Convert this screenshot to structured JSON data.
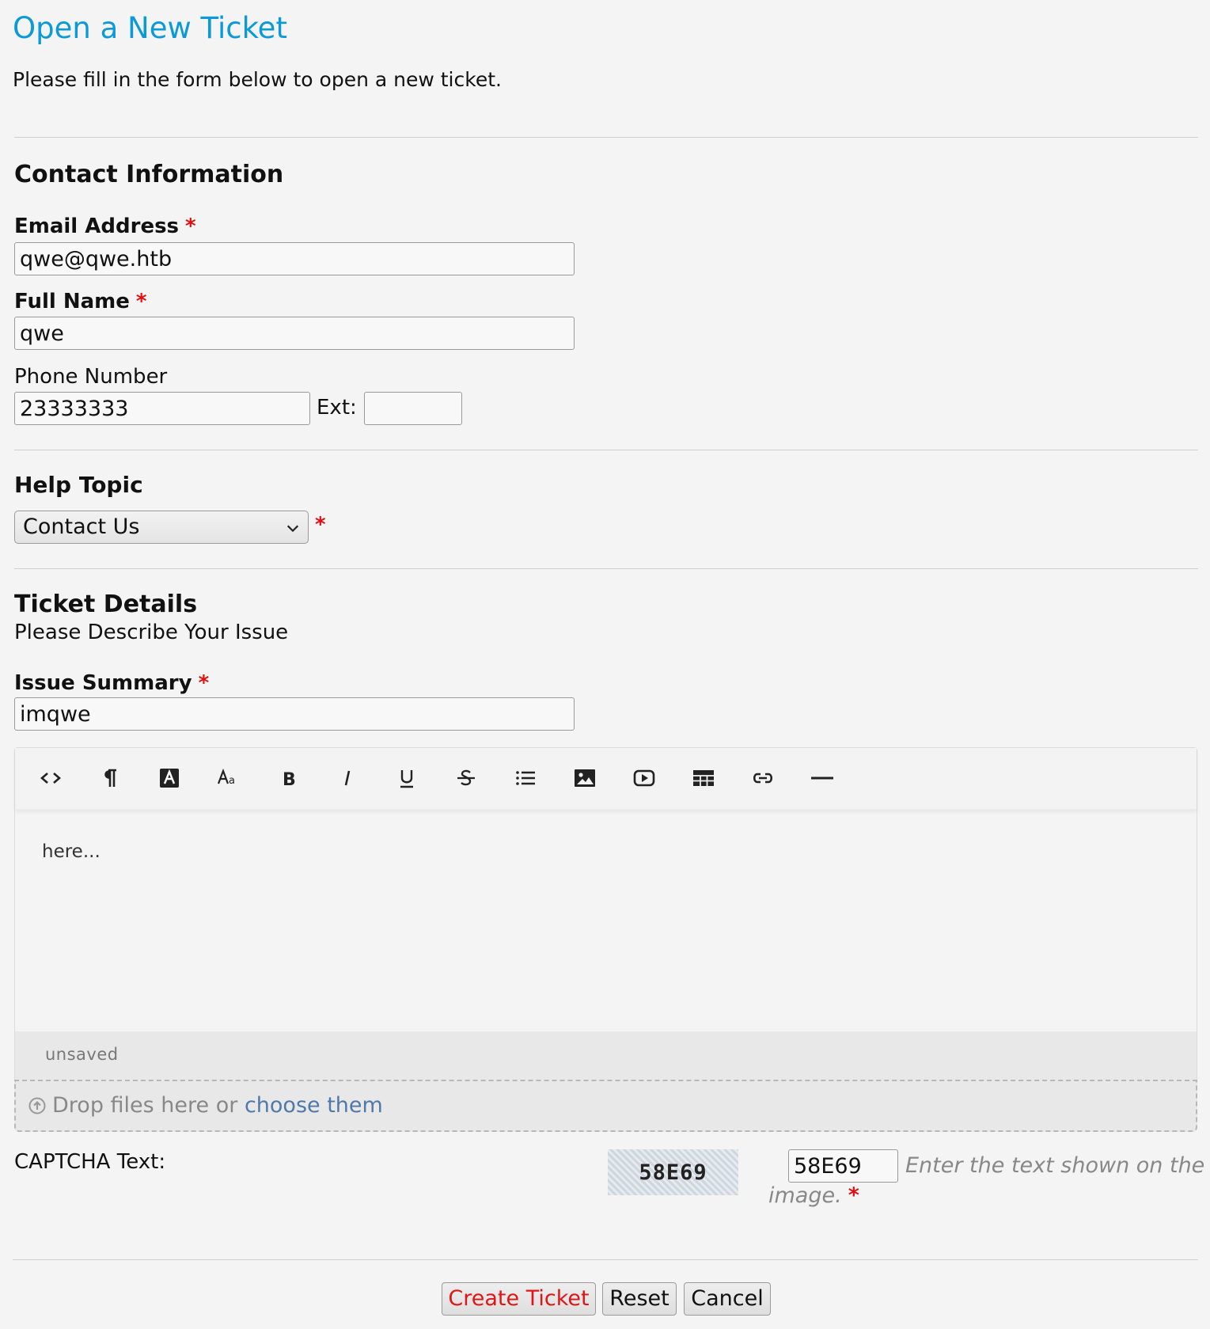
{
  "page": {
    "title": "Open a New Ticket",
    "intro": "Please fill in the form below to open a new ticket."
  },
  "contact": {
    "heading": "Contact Information",
    "email_label": "Email Address",
    "email_value": "qwe@qwe.htb",
    "name_label": "Full Name",
    "name_value": "qwe",
    "phone_label": "Phone Number",
    "phone_value": "23333333",
    "ext_label": "Ext:",
    "ext_value": "",
    "required_mark": "*"
  },
  "help_topic": {
    "heading": "Help Topic",
    "selected": "Contact Us",
    "required_mark": "*"
  },
  "ticket_details": {
    "heading": "Ticket Details",
    "subheading": "Please Describe Your Issue",
    "summary_label": "Issue Summary",
    "summary_value": "imqwe",
    "required_mark": "*"
  },
  "editor": {
    "toolbar": [
      {
        "name": "html-view",
        "icon": "code-icon"
      },
      {
        "name": "paragraph-format",
        "icon": "pilcrow-icon"
      },
      {
        "name": "text-color",
        "icon": "text-color-icon"
      },
      {
        "name": "font-size",
        "icon": "font-size-icon"
      },
      {
        "name": "bold",
        "icon": "bold-icon"
      },
      {
        "name": "italic",
        "icon": "italic-icon"
      },
      {
        "name": "underline",
        "icon": "underline-icon"
      },
      {
        "name": "strikethrough",
        "icon": "strikethrough-icon"
      },
      {
        "name": "list",
        "icon": "list-icon"
      },
      {
        "name": "insert-image",
        "icon": "image-icon"
      },
      {
        "name": "insert-video",
        "icon": "video-icon"
      },
      {
        "name": "insert-table",
        "icon": "table-icon"
      },
      {
        "name": "insert-link",
        "icon": "link-icon"
      },
      {
        "name": "horizontal-rule",
        "icon": "horizontal-rule-icon"
      }
    ],
    "body_text": "here...",
    "status": "unsaved"
  },
  "attachments": {
    "icon": "upload-icon",
    "text": "Drop files here or",
    "link": "choose them"
  },
  "captcha": {
    "label": "CAPTCHA Text:",
    "image_text": "58E69",
    "value": "58E69",
    "hint_line1": "Enter the text shown on the",
    "hint_line2": "image.",
    "required_mark": "*"
  },
  "buttons": {
    "create": "Create Ticket",
    "reset": "Reset",
    "cancel": "Cancel"
  },
  "colors": {
    "title": "#0b9ad7",
    "required": "#e01010",
    "link": "#4f79a8",
    "primary_button_text": "#e01515"
  }
}
